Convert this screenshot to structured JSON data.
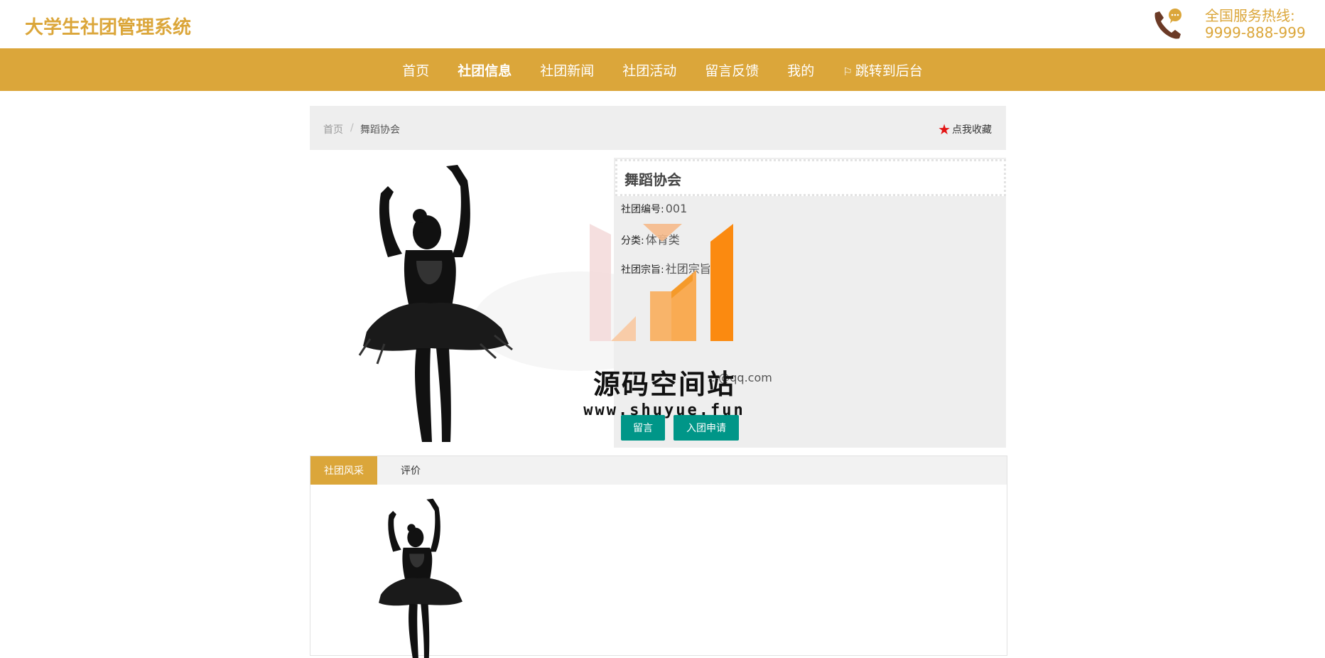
{
  "header": {
    "site_title": "大学生社团管理系统",
    "hotline_label": "全国服务热线:",
    "hotline_number": "9999-888-999",
    "phone_icon": "phone-chat-icon"
  },
  "nav": {
    "items": [
      "首页",
      "社团信息",
      "社团新闻",
      "社团活动",
      "留言反馈",
      "我的",
      "跳转到后台"
    ],
    "active_index": 1,
    "backend_icon": "flag-icon"
  },
  "breadcrumb": {
    "home": "首页",
    "separator": "/",
    "current": "舞蹈协会",
    "favorite_label": "点我收藏",
    "favorite_icon": "star-icon"
  },
  "detail": {
    "title": "舞蹈协会",
    "rows": [
      {
        "label": "社团编号:",
        "value": "001"
      },
      {
        "label": "分类:",
        "value": "体育类"
      },
      {
        "label": "社团宗旨:",
        "value": "社团宗旨5"
      }
    ],
    "contact_value": "...@qq.com",
    "buttons": {
      "message": "留言",
      "apply": "入团申请"
    },
    "image": "ballet-dancer-silhouette"
  },
  "tabs": {
    "items": [
      "社团风采",
      "评价"
    ],
    "active_index": 0
  },
  "watermark": {
    "text": "源码空间站",
    "url": "www.shuyue.fun"
  },
  "colors": {
    "brand": "#dba63a",
    "button": "#009688",
    "panel": "#eeeeee"
  }
}
